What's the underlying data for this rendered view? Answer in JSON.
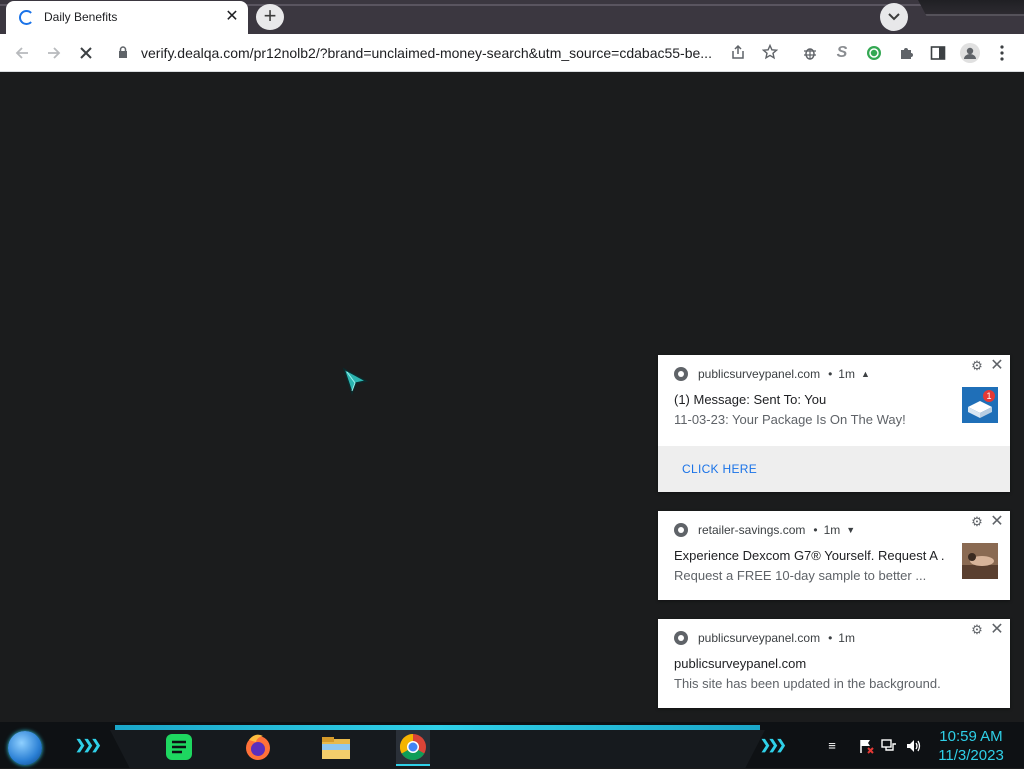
{
  "browser": {
    "tab": {
      "title": "Daily Benefits"
    },
    "address_bar": {
      "url": "verify.dealqa.com/pr12nolb2/?brand=unclaimed-money-search&utm_source=cdabac55-be..."
    }
  },
  "notifications": [
    {
      "origin": "publicsurveypanel.com",
      "time": "1m",
      "title": "(1) Message: Sent To: You",
      "body": "11-03-23: Your Package Is On The Way!",
      "action": "CLICK HERE",
      "expanded": true
    },
    {
      "origin": "retailer-savings.com",
      "time": "1m",
      "title": "Experience Dexcom G7® Yourself. Request A ...",
      "body": "Request a FREE 10-day sample to better ...",
      "expanded": false
    },
    {
      "origin": "publicsurveypanel.com",
      "time": "1m",
      "title": "publicsurveypanel.com",
      "body": "This site has been updated in the background."
    }
  ],
  "taskbar": {
    "apps": [
      "spreadsheet-app-icon",
      "firefox-icon",
      "file-explorer-icon",
      "chrome-icon"
    ],
    "clock": {
      "time": "10:59 AM",
      "date": "11/3/2023"
    },
    "accent": "#2fd0e8"
  },
  "colors": {
    "page_background": "#1b1c1d",
    "link": "#1a73e8"
  }
}
